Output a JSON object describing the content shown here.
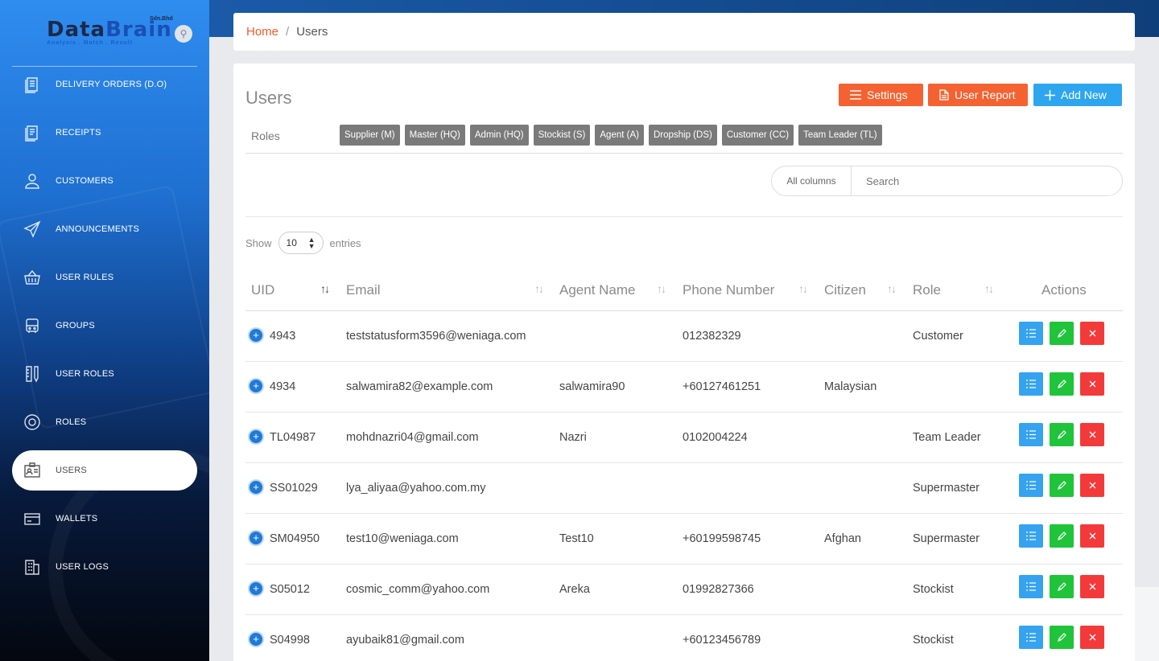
{
  "brand": {
    "name_a": "Data",
    "name_b": "Brain",
    "suffix": "Sdn.Bhd",
    "tagline": "Analysis . Match . Result"
  },
  "sidebar": {
    "items": [
      {
        "label": "DELIVERY ORDERS (D.O)",
        "icon": "document-icon"
      },
      {
        "label": "RECEIPTS",
        "icon": "receipt-icon"
      },
      {
        "label": "CUSTOMERS",
        "icon": "person-icon"
      },
      {
        "label": "ANNOUNCEMENTS",
        "icon": "paper-plane-icon"
      },
      {
        "label": "USER RULES",
        "icon": "basket-icon"
      },
      {
        "label": "GROUPS",
        "icon": "bus-icon"
      },
      {
        "label": "USER ROLES",
        "icon": "pencil-ruler-icon"
      },
      {
        "label": "ROLES",
        "icon": "at-icon"
      },
      {
        "label": "USERS",
        "icon": "id-card-icon",
        "active": true
      },
      {
        "label": "WALLETS",
        "icon": "wallet-icon"
      },
      {
        "label": "USER LOGS",
        "icon": "building-icon"
      }
    ]
  },
  "breadcrumb": {
    "home": "Home",
    "separator": "/",
    "current": "Users"
  },
  "page": {
    "title": "Users",
    "buttons": {
      "settings": "Settings",
      "report": "User Report",
      "add": "Add New"
    },
    "roles_label": "Roles",
    "roles": [
      "Supplier (M)",
      "Master (HQ)",
      "Admin (HQ)",
      "Stockist (S)",
      "Agent (A)",
      "Dropship (DS)",
      "Customer (CC)",
      "Team Leader (TL)"
    ],
    "search": {
      "column": "All columns",
      "placeholder": "Search"
    },
    "show": {
      "prefix": "Show",
      "value": "10",
      "suffix": "entries"
    }
  },
  "table": {
    "columns": [
      "UID",
      "Email",
      "Agent Name",
      "Phone Number",
      "Citizen",
      "Role",
      "Actions"
    ],
    "rows": [
      {
        "uid": "4943",
        "email": "teststatusform3596@weniaga.com",
        "agent": "",
        "phone": "012382329",
        "citizen": "",
        "role": "Customer"
      },
      {
        "uid": "4934",
        "email": "salwamira82@example.com",
        "agent": "salwamira90",
        "phone": "+60127461251",
        "citizen": "Malaysian",
        "role": ""
      },
      {
        "uid": "TL04987",
        "email": "mohdnazri04@gmail.com",
        "agent": "Nazri",
        "phone": "0102004224",
        "citizen": "",
        "role": "Team Leader"
      },
      {
        "uid": "SS01029",
        "email": "lya_aliyaa@yahoo.com.my",
        "agent": "",
        "phone": "",
        "citizen": "",
        "role": "Supermaster"
      },
      {
        "uid": "SM04950",
        "email": "test10@weniaga.com",
        "agent": "Test10",
        "phone": "+60199598745",
        "citizen": "Afghan",
        "role": "Supermaster"
      },
      {
        "uid": "S05012",
        "email": "cosmic_comm@yahoo.com",
        "agent": "Areka",
        "phone": "01992827366",
        "citizen": "",
        "role": "Stockist"
      },
      {
        "uid": "S04998",
        "email": "ayubaik81@gmail.com",
        "agent": "",
        "phone": "+60123456789",
        "citizen": "",
        "role": "Stockist"
      }
    ]
  },
  "colors": {
    "orange": "#f56232",
    "blue": "#2ea6ef",
    "green": "#1fc43a",
    "red": "#f33a3a"
  }
}
